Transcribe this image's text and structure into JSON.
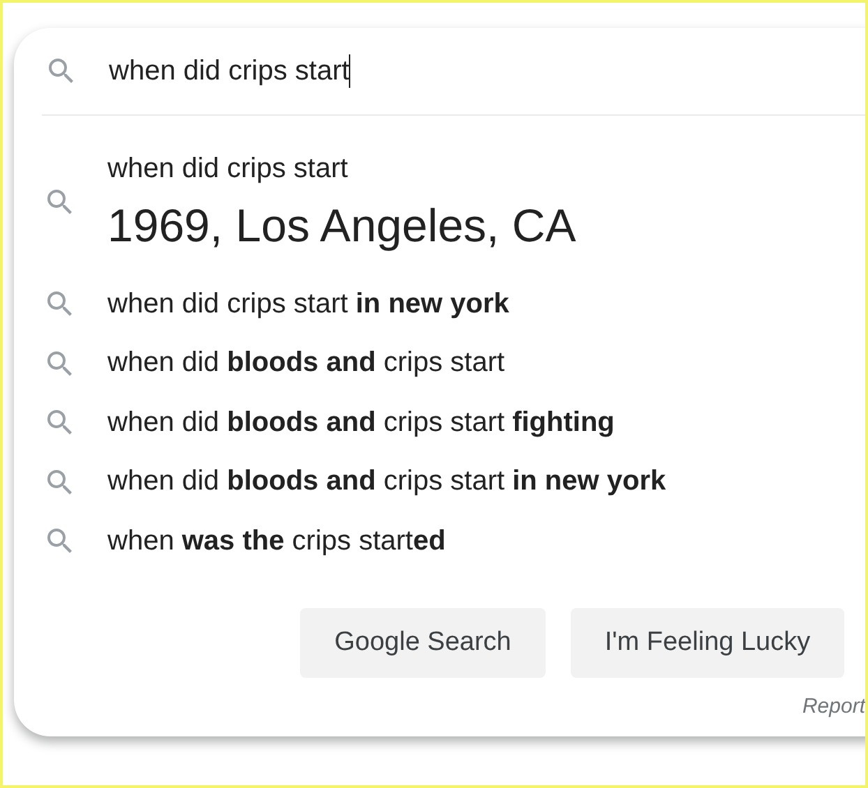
{
  "search": {
    "value": "when did crips start",
    "focused": true
  },
  "suggestions": [
    {
      "kind": "answer",
      "query": "when did crips start",
      "answer": "1969, Los Angeles, CA"
    },
    {
      "kind": "query",
      "text": "when did crips start **in new york**"
    },
    {
      "kind": "query",
      "text": "when did **bloods and** crips start"
    },
    {
      "kind": "query",
      "text": "when did **bloods and** crips start **fighting**"
    },
    {
      "kind": "query",
      "text": "when did **bloods and** crips start **in new york**"
    },
    {
      "kind": "query",
      "text": "when **was the** crips start**ed**"
    }
  ],
  "buttons": [
    "Google Search",
    "I'm Feeling Lucky"
  ],
  "report_link": "Report"
}
